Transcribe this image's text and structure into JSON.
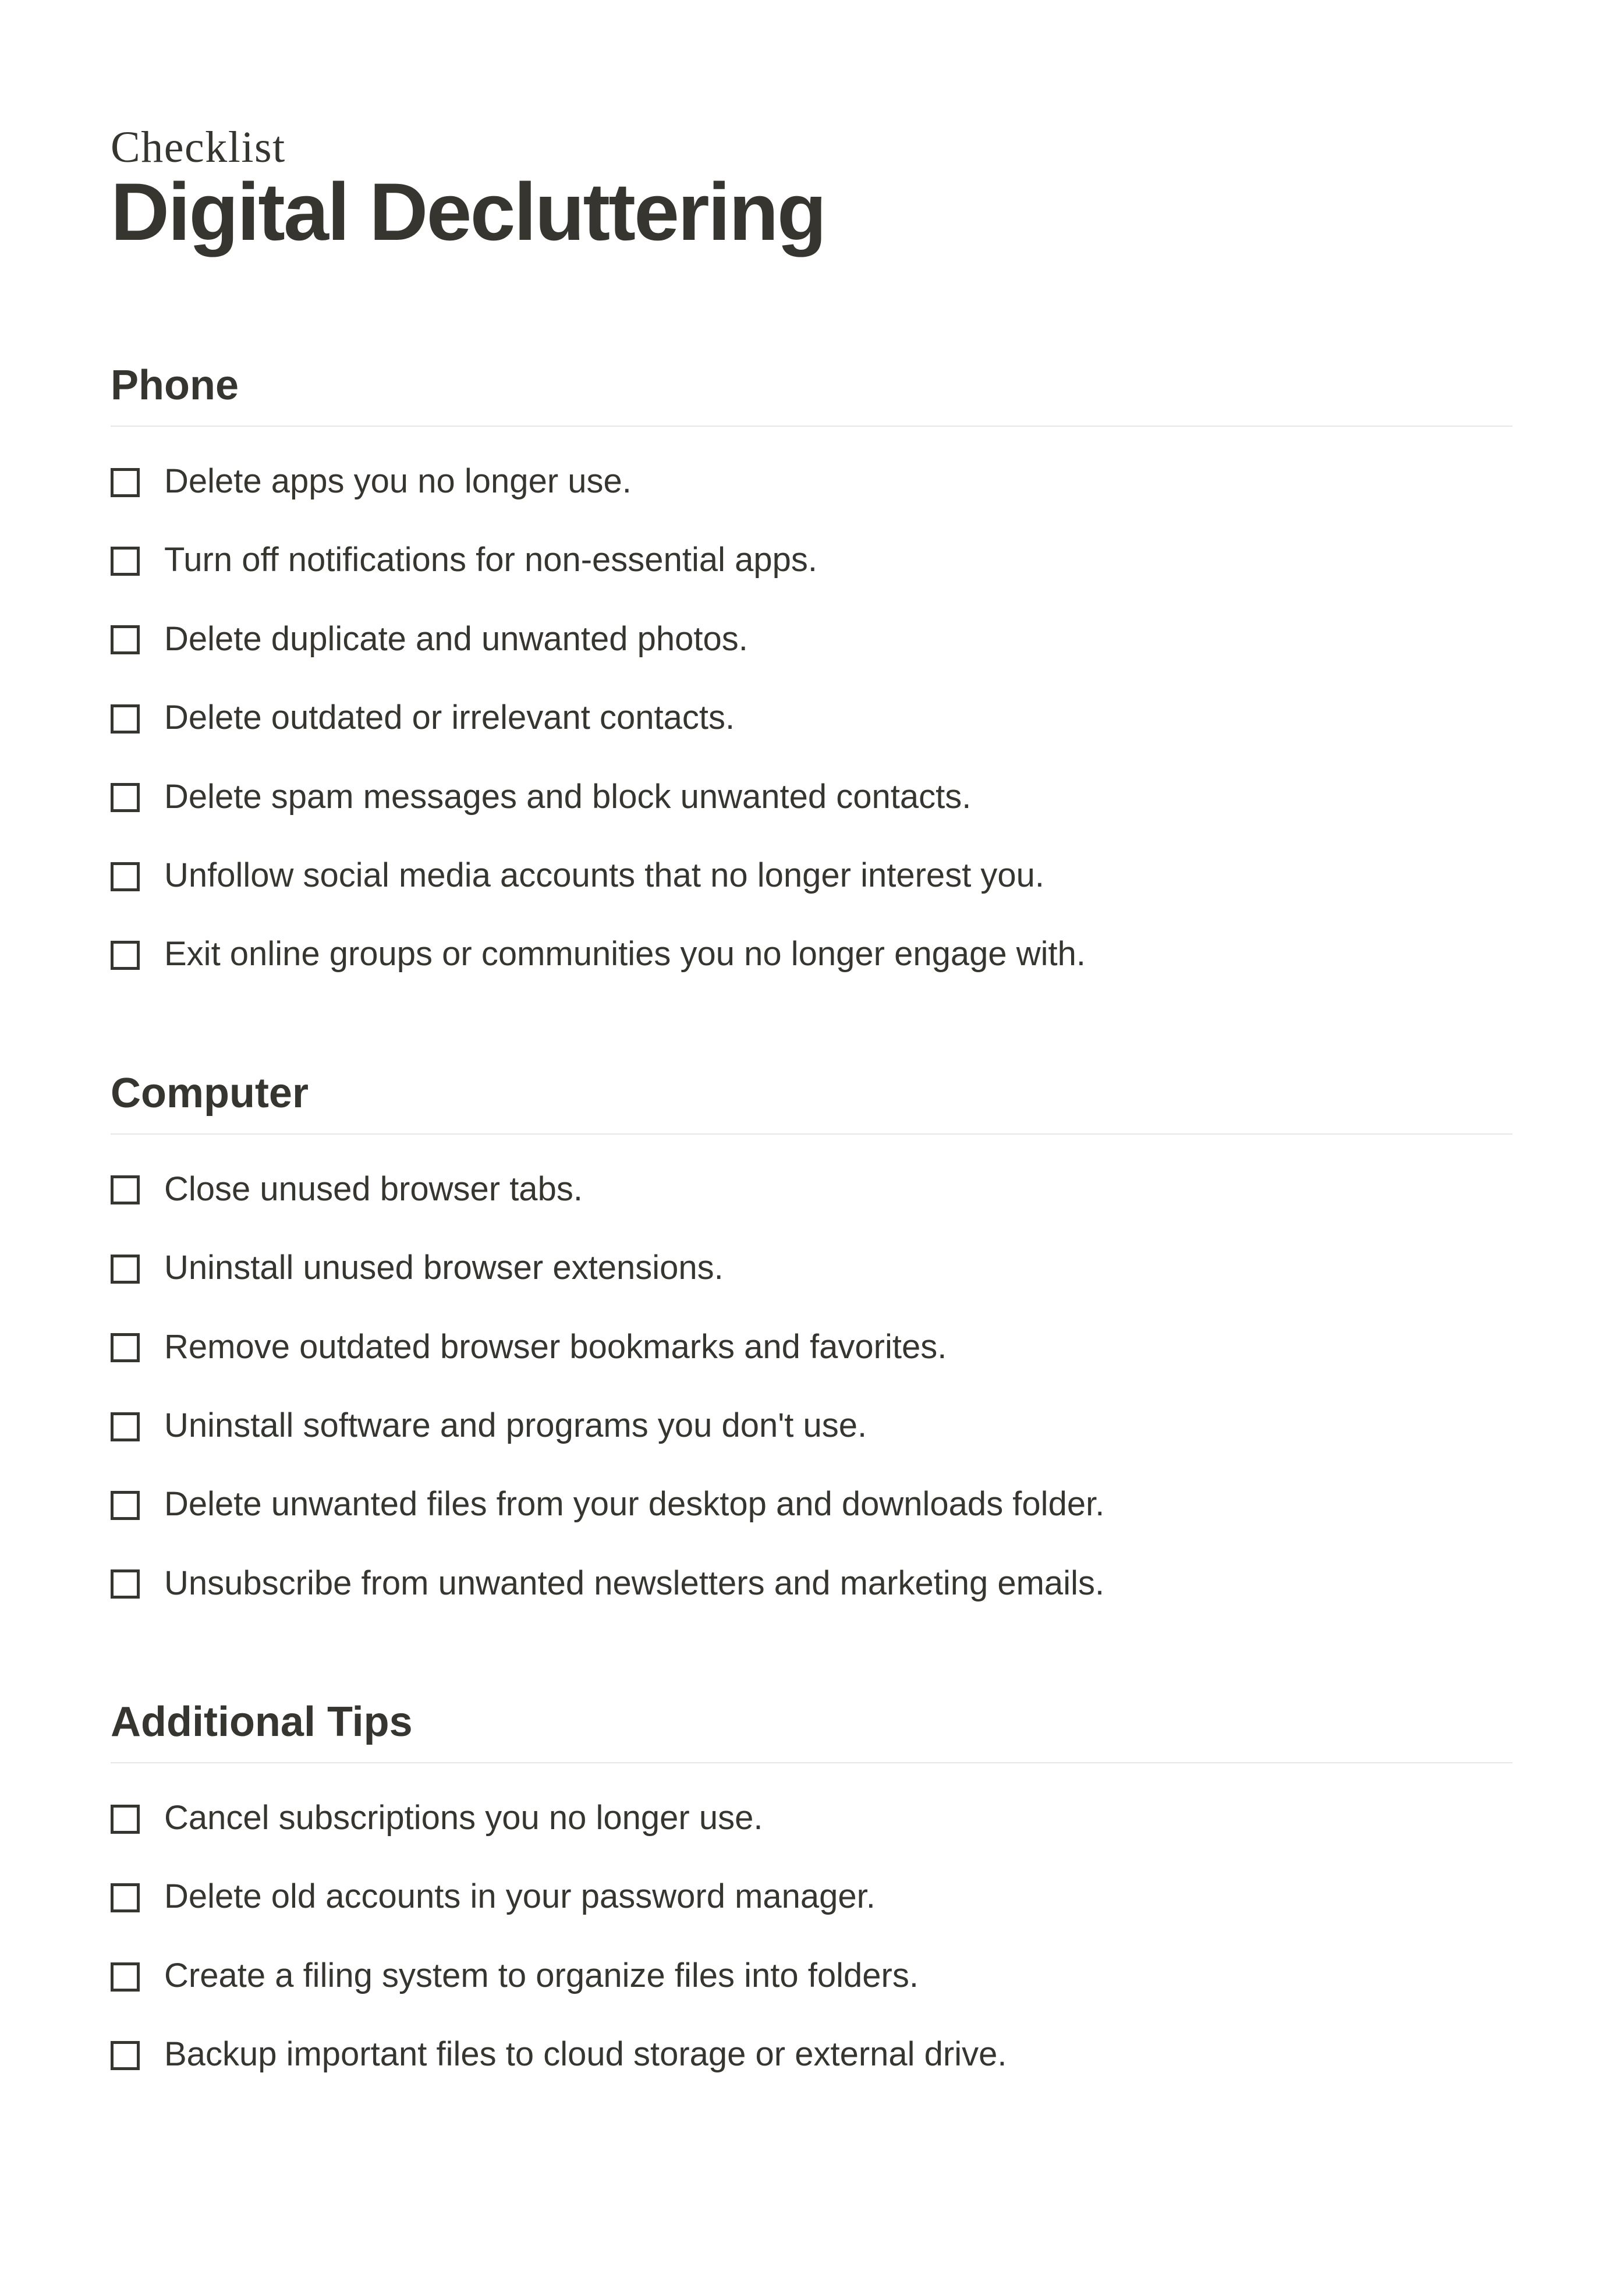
{
  "pretitle": "Checklist",
  "title": "Digital Decluttering",
  "sections": [
    {
      "heading": "Phone",
      "items": [
        "Delete apps you no longer use.",
        "Turn off notifications for non-essential apps.",
        "Delete duplicate and unwanted photos.",
        "Delete outdated or irrelevant contacts.",
        "Delete spam messages and block unwanted contacts.",
        "Unfollow social media accounts that no longer interest you.",
        "Exit online groups or communities you no longer engage with."
      ]
    },
    {
      "heading": "Computer",
      "items": [
        "Close unused browser tabs.",
        "Uninstall unused browser extensions.",
        "Remove outdated browser bookmarks and favorites.",
        "Uninstall software and programs you don't use.",
        "Delete unwanted files from your desktop and downloads folder.",
        "Unsubscribe from unwanted newsletters and marketing emails."
      ]
    },
    {
      "heading": "Additional Tips",
      "items": [
        "Cancel subscriptions you no longer use.",
        "Delete old accounts in your password manager.",
        "Create a filing system to organize files into folders.",
        "Backup important files to cloud storage or external drive."
      ]
    }
  ]
}
